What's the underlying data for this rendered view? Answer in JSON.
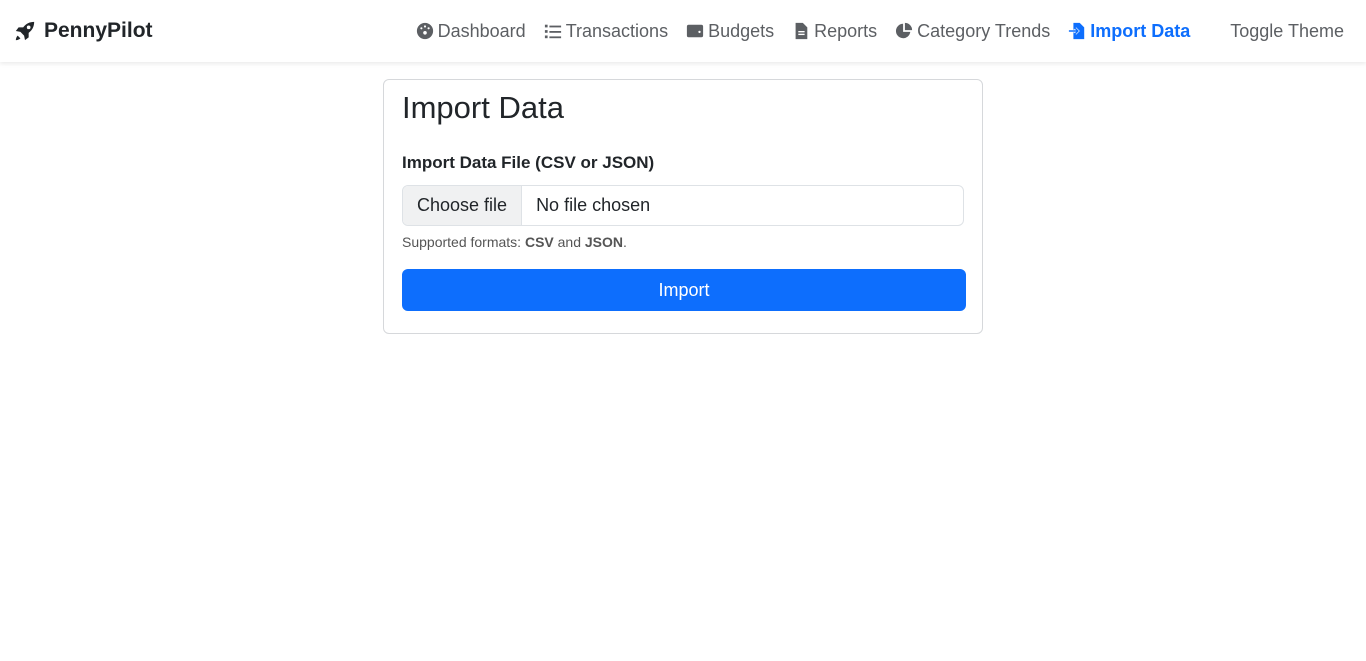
{
  "brand": {
    "name": "PennyPilot",
    "icon": "rocket-icon"
  },
  "nav": [
    {
      "label": "Dashboard",
      "icon": "gauge-icon"
    },
    {
      "label": "Transactions",
      "icon": "list-icon"
    },
    {
      "label": "Budgets",
      "icon": "wallet-icon"
    },
    {
      "label": "Reports",
      "icon": "file-icon"
    },
    {
      "label": "Category Trends",
      "icon": "pie-chart-icon"
    },
    {
      "label": "Import Data",
      "icon": "file-import-icon",
      "active": true
    },
    {
      "label": "Toggle Theme",
      "icon": "moon-icon"
    }
  ],
  "colors": {
    "accent": "#0d6efd"
  },
  "card": {
    "title": "Import Data",
    "label": "Import Data File (CSV or JSON)",
    "choose": "Choose file",
    "file": "No file chosen",
    "help_prefix": "Supported formats: ",
    "fmt1": "CSV",
    "and": " and ",
    "fmt2": "JSON",
    "period": ".",
    "button": "Import"
  }
}
